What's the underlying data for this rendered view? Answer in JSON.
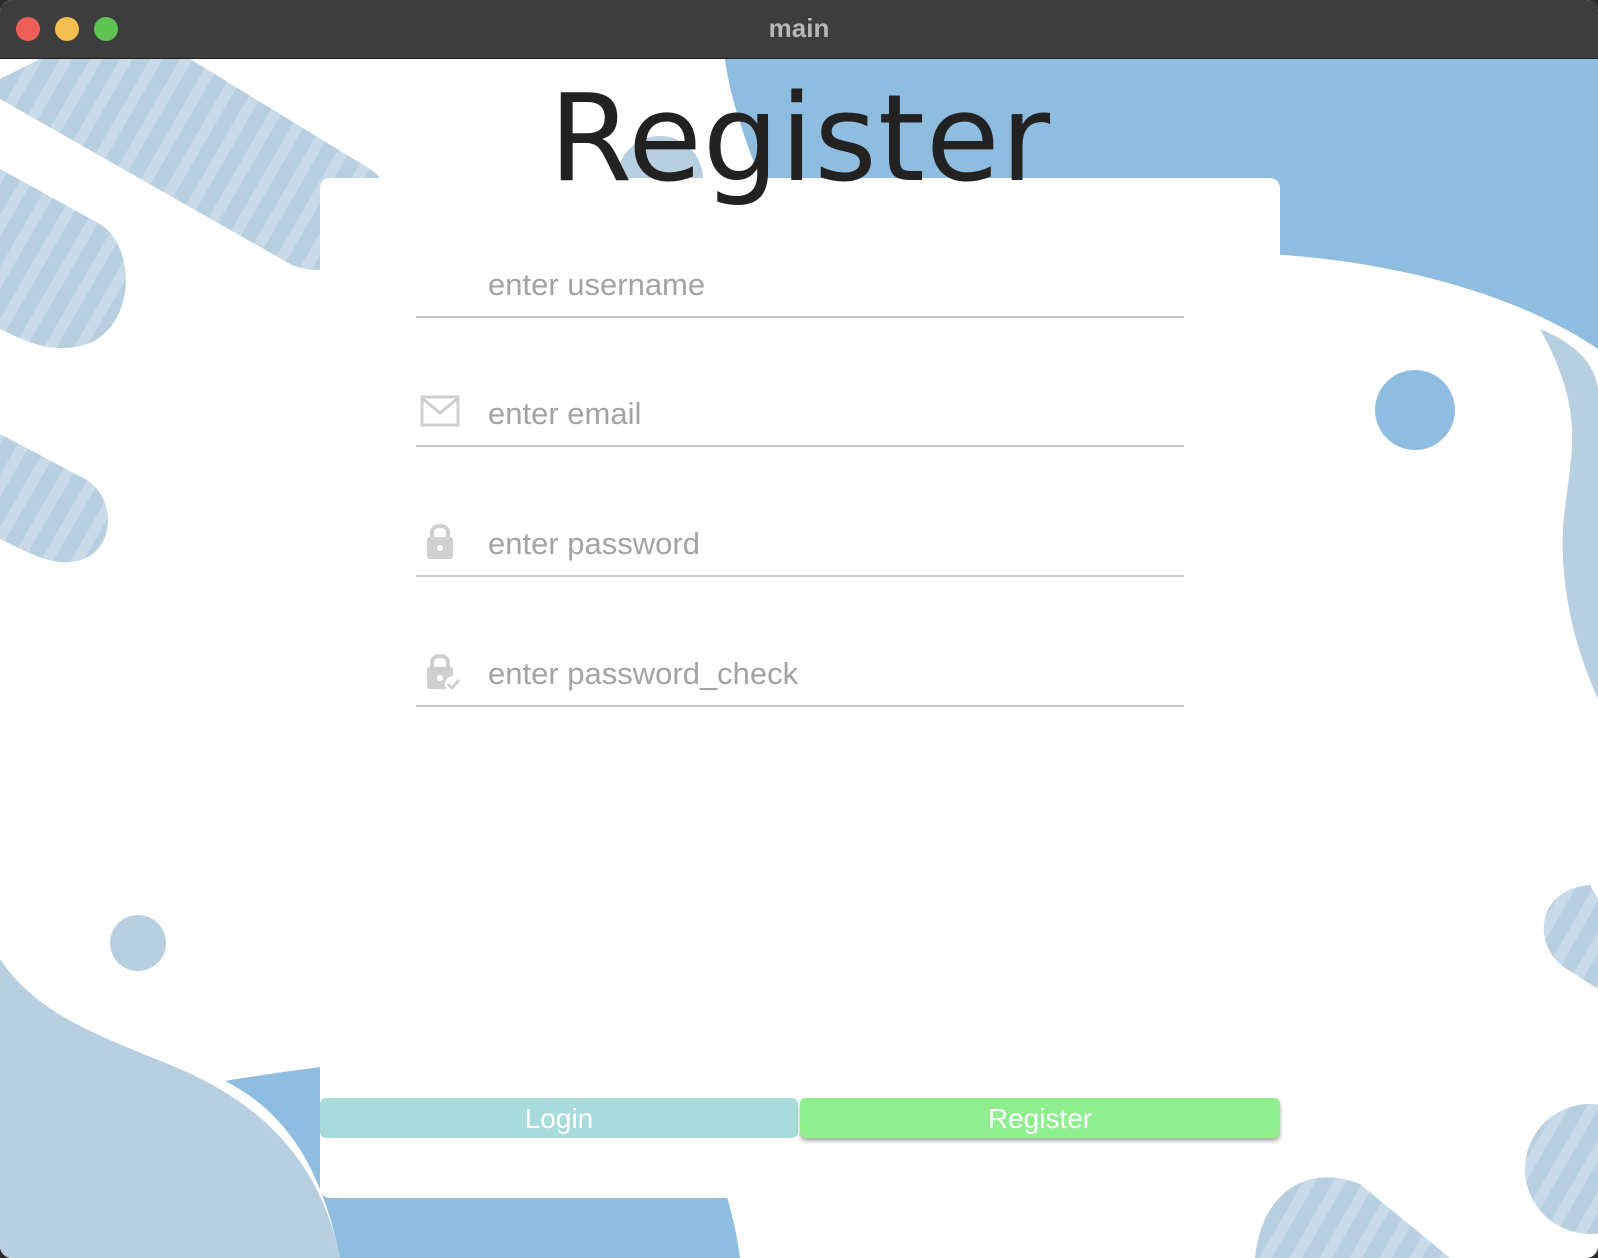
{
  "window": {
    "title": "main"
  },
  "form": {
    "heading": "Register",
    "username": {
      "placeholder": "enter username",
      "icon": "user-icon"
    },
    "email": {
      "placeholder": "enter email",
      "icon": "mail-icon"
    },
    "password": {
      "placeholder": "enter password",
      "icon": "lock-icon"
    },
    "password_check": {
      "placeholder": "enter password_check",
      "icon": "lock-check-icon"
    }
  },
  "buttons": {
    "login_label": "Login",
    "register_label": "Register"
  },
  "colors": {
    "blob_blue": "#8fbde0",
    "blob_grey": "#b8cfe0",
    "login_button": "#a9dadc",
    "register_button": "#8fef8f",
    "titlebar": "#3d3d3d"
  }
}
